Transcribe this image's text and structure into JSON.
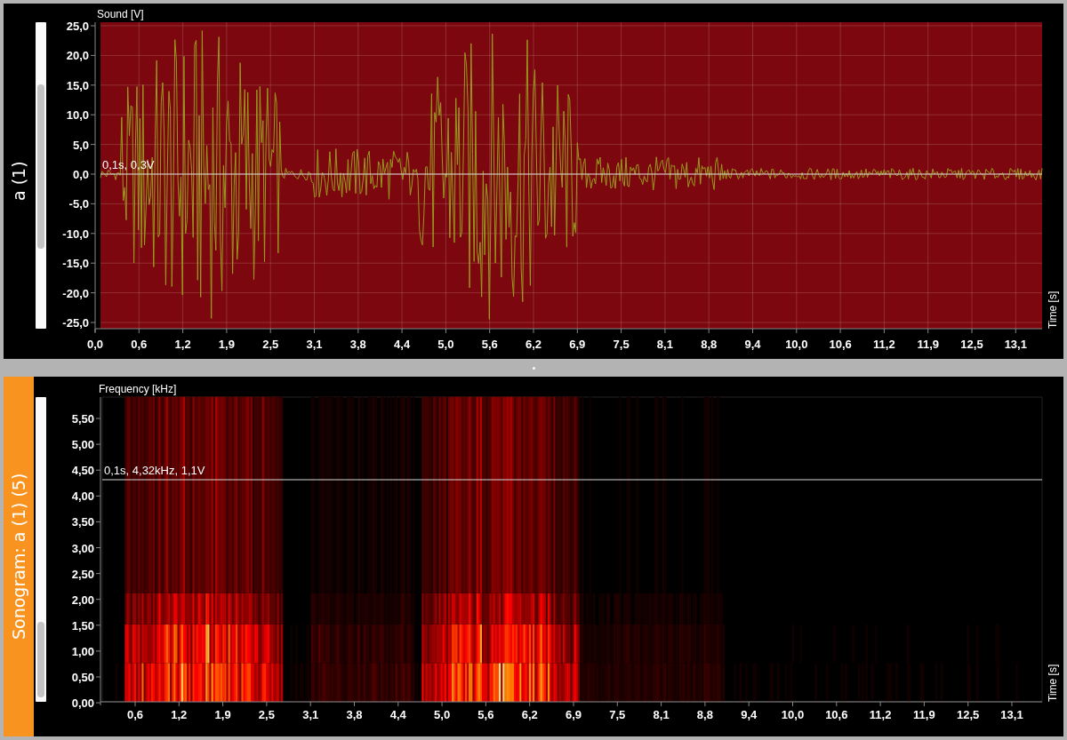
{
  "panels": [
    {
      "kind": "waveform",
      "title": "a (1)",
      "selected": false,
      "y_axis_title": "Sound [V]",
      "x_axis_title": "Time [s]",
      "cursor_readout": "0,1s, 0,3V",
      "y_ticks": [
        "25,0",
        "20,0",
        "15,0",
        "10,0",
        "5,0",
        "0,0",
        "-5,0",
        "-10,0",
        "-15,0",
        "-20,0",
        "-25,0"
      ],
      "x_ticks": [
        "0,0",
        "0,6",
        "1,2",
        "1,9",
        "2,5",
        "3,1",
        "3,8",
        "4,4",
        "5,0",
        "5,6",
        "6,2",
        "6,9",
        "7,5",
        "8,1",
        "8,8",
        "9,4",
        "10,0",
        "10,6",
        "11,2",
        "11,9",
        "12,5",
        "13,1"
      ]
    },
    {
      "kind": "sonogram",
      "title": "Sonogram: a (1) (5)",
      "selected": true,
      "y_axis_title": "Frequency [kHz]",
      "x_axis_title": "Time [s]",
      "cursor_readout": "0,1s, 4,32kHz, 1,1V",
      "y_ticks": [
        "5,50",
        "5,00",
        "4,50",
        "4,00",
        "3,50",
        "3,00",
        "2,50",
        "2,00",
        "1,50",
        "1,00",
        "0,50",
        "0,00"
      ],
      "x_ticks": [
        "0,6",
        "1,2",
        "1,9",
        "2,5",
        "3,1",
        "3,8",
        "4,4",
        "5,0",
        "5,6",
        "6,2",
        "6,9",
        "7,5",
        "8,1",
        "8,8",
        "9,4",
        "10,0",
        "10,6",
        "11,2",
        "11,9",
        "12,5",
        "13,1"
      ]
    }
  ]
}
